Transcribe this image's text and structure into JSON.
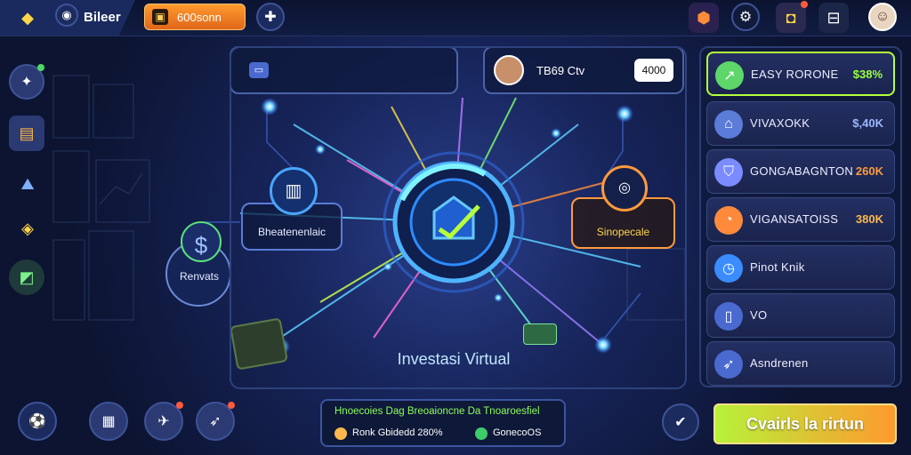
{
  "topbar": {
    "app_name": "Bileer",
    "balance_label": "600sonn",
    "icons": [
      "home-icon",
      "profile-icon",
      "wallet-icon",
      "plus-icon",
      "gift-icon",
      "settings-icon",
      "notification-icon",
      "menu-icon",
      "avatar"
    ]
  },
  "header": {
    "left_panel_icon": "gamepad-icon",
    "player_name": "TB69 Ctv",
    "player_score": "4000"
  },
  "center": {
    "title": "Investasi Virtual",
    "node_left_label": "Bheatenenlaic",
    "node_right_label": "Sinopecale",
    "node_bottom_left_label": "Renvats"
  },
  "right_panel": {
    "items": [
      {
        "label": "EASY RORONE",
        "value": "$38%",
        "value_color": "#9cff44",
        "icon": "chart-up-icon"
      },
      {
        "label": "VIVAXOKK",
        "value": "$,40K",
        "value_color": "#9db8ff",
        "icon": "bank-icon"
      },
      {
        "label": "GONGABAGNTON",
        "value": "260K",
        "value_color": "#ff9a3c",
        "icon": "shield-icon"
      },
      {
        "label": "VIGANSATOISS",
        "value": "380K",
        "value_color": "#ffb84c",
        "icon": "chart-circle-icon"
      },
      {
        "label": "Pinot Knik",
        "value": "",
        "value_color": "#ffffff",
        "icon": "clock-icon"
      },
      {
        "label": "VO",
        "value": "",
        "value_color": "#ffffff",
        "icon": "phone-icon"
      },
      {
        "label": "Asndrenen",
        "value": "",
        "value_color": "#ffffff",
        "icon": "rocket-icon"
      }
    ]
  },
  "footer": {
    "info_line1": "Hnoecoies Dag Breoaioncne Da Tnoaroesfiel",
    "info_line2": "Ronk Gbidedd 280%",
    "info_line3": "GonecoOS",
    "cta_label": "Cvairls la rirtun"
  }
}
